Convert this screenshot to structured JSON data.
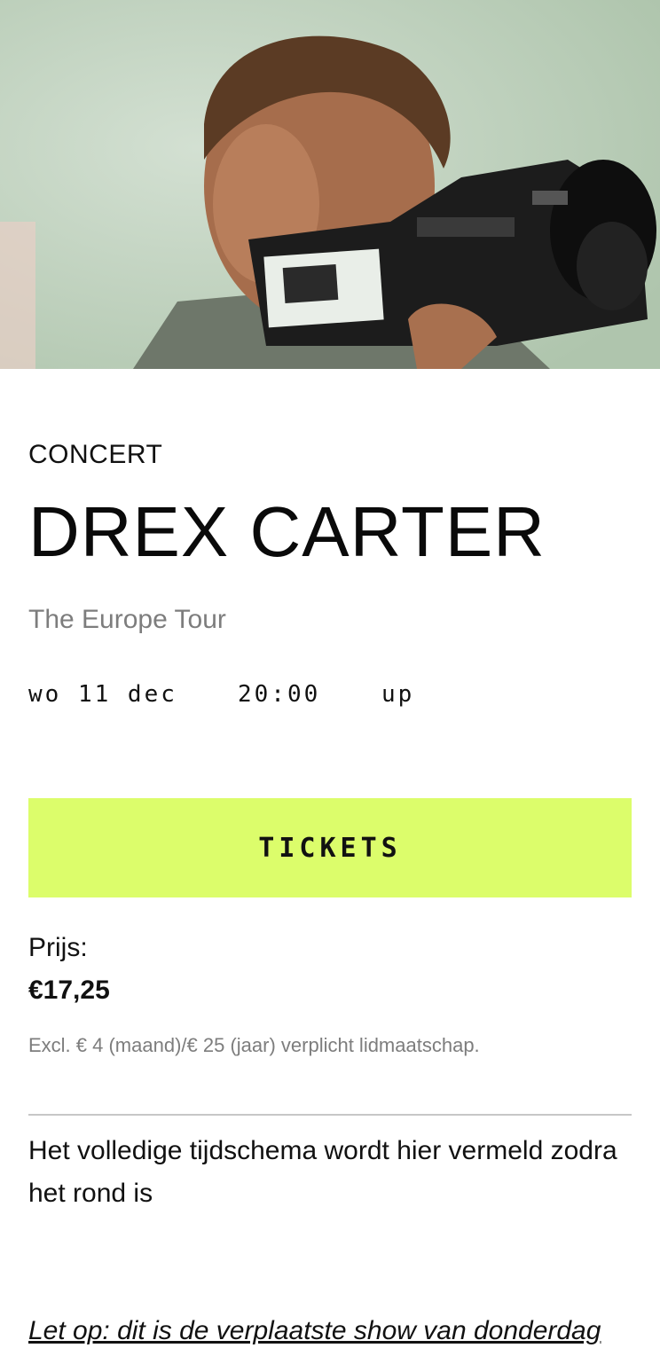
{
  "hero": {
    "image_label": "event-photo",
    "colors": {
      "background": "#c9d8c7",
      "camera": "#1a1a1a",
      "skin": "#b07a5a",
      "hair": "#5a3a24"
    }
  },
  "event": {
    "category": "CONCERT",
    "title": "DREX CARTER",
    "subtitle": "The Europe Tour",
    "date": "wo 11 dec",
    "time": "20:00",
    "venue": "up"
  },
  "tickets": {
    "label": "TICKETS",
    "color": "#dcfd6b"
  },
  "price": {
    "label": "Prijs:",
    "value": "€17,25",
    "membership_note": "Excl. € 4 (maand)/€ 25 (jaar) verplicht lidmaatschap."
  },
  "schedule_text": "Het volledige tijdschema wordt hier vermeld zodra het rond is",
  "note": "Let op: dit is de verplaatste show van donderdag"
}
